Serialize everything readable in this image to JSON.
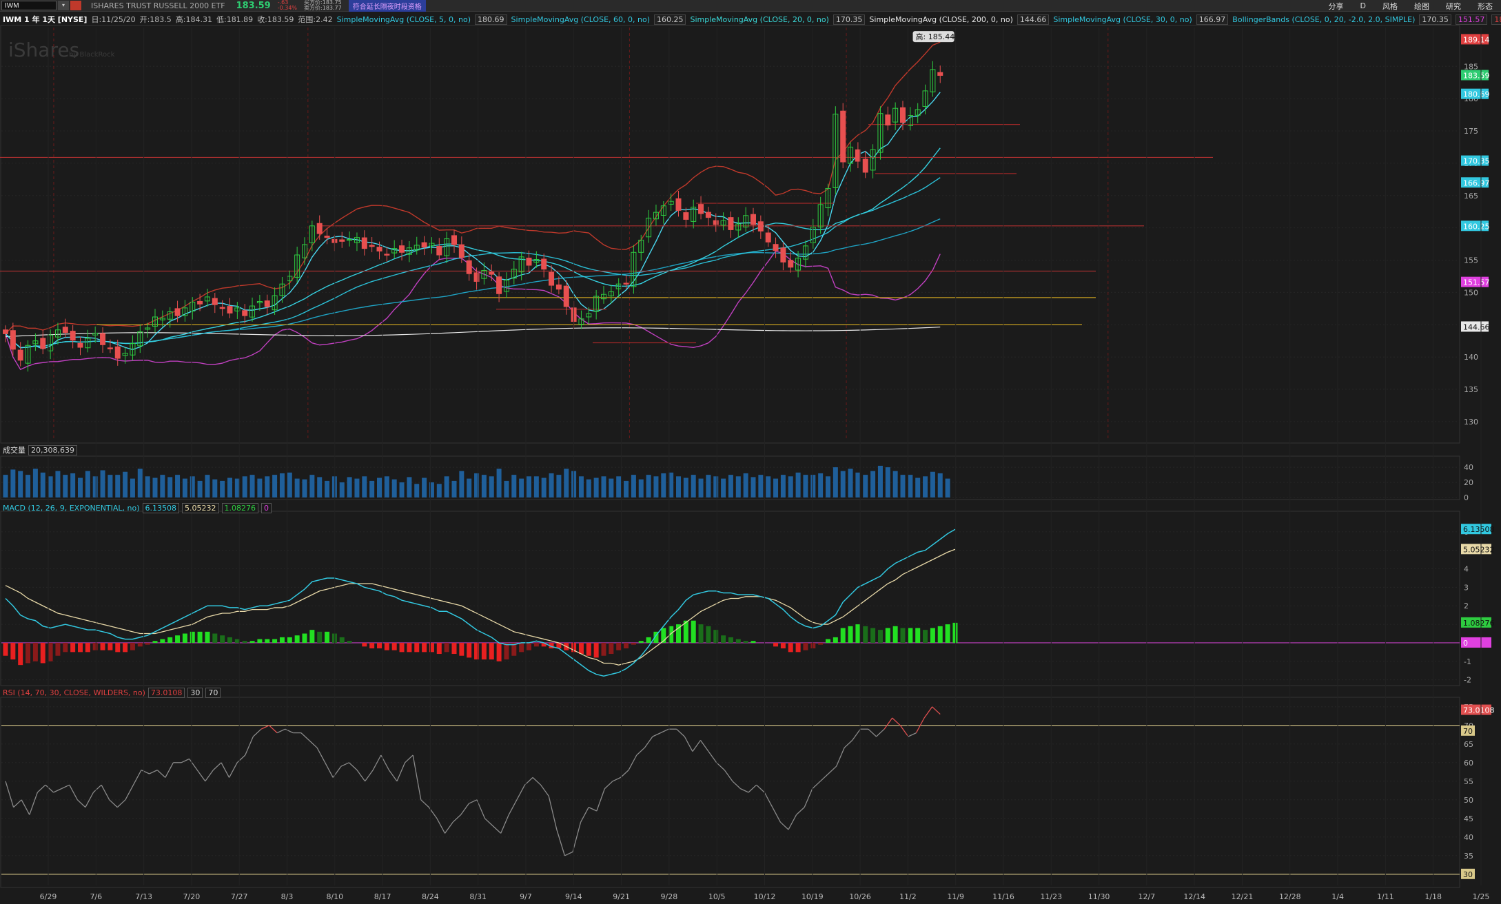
{
  "toolbar": {
    "symbol": "IWM",
    "name": "ISHARES TRUST RUSSELL 2000 ETF",
    "price": "183.59",
    "change": "-.63",
    "change_pct": "-0.34%",
    "bid": "买方价:183.75",
    "ask": "卖方价:183.77",
    "ext_hours": "符合延长隔夜时段资格",
    "right_items": [
      "分享",
      "D",
      "风格",
      "绘图",
      "研究",
      "形态"
    ]
  },
  "infobar": {
    "title": "IWM 1 年 1天 [NYSE]",
    "date": "日:11/25/20",
    "open": "开:183.5",
    "high": "高:184.31",
    "low": "低:181.89",
    "close": "收:183.59",
    "range": "范围:2.42",
    "studies": [
      {
        "label": "SimpleMovingAvg (CLOSE, 5, 0, no)",
        "value": "180.69",
        "color": "#32c8e0"
      },
      {
        "label": "SimpleMovingAvg (CLOSE, 60, 0, no)",
        "value": "160.25",
        "color": "#32c8e0"
      },
      {
        "label": "SimpleMovingAvg (CLOSE, 20, 0, no)",
        "value": "170.35",
        "color": "#32c8e0"
      },
      {
        "label": "SimpleMovingAvg (CLOSE, 200, 0, no)",
        "value": "144.66",
        "color": "#e8e8e8"
      },
      {
        "label": "SimpleMovingAvg (CLOSE, 30, 0, no)",
        "value": "166.97",
        "color": "#32c8e0"
      },
      {
        "label": "BollingerBands (CLOSE, 0, 20, -2.0, 2.0, SIMPLE)",
        "value": "170.35",
        "color": "#32c8e0"
      }
    ],
    "bb_lower": "151.57",
    "bb_upper": "189.14"
  },
  "watermark": "iShares",
  "watermark_sub": "by BlackRock",
  "high_tag": "高: 185.44",
  "volume_label": "成交量",
  "volume_value": "20,308,639",
  "macd_label": "MACD (12, 26, 9, EXPONENTIAL, no)",
  "macd_values": [
    "6.13508",
    "5.05232",
    "1.08276",
    "0"
  ],
  "rsi_label": "RSI (14, 70, 30, CLOSE, WILDERS, no)",
  "rsi_values": [
    "73.0108",
    "30",
    "70"
  ],
  "price_badges": [
    {
      "value": "189.14",
      "color": "#e04040",
      "y": 189.14
    },
    {
      "value": "183.59",
      "color": "#2ecc71",
      "y": 183.59
    },
    {
      "value": "180.69",
      "color": "#32c8e0",
      "y": 180.69
    },
    {
      "value": "170.35",
      "color": "#32c8e0",
      "y": 170.35
    },
    {
      "value": "166.97",
      "color": "#32c8e0",
      "y": 166.97
    },
    {
      "value": "160.25",
      "color": "#32c8e0",
      "y": 160.25
    },
    {
      "value": "151.57",
      "color": "#e040e0",
      "y": 151.57
    },
    {
      "value": "144.66",
      "color": "#e8e8e8",
      "y": 144.66
    }
  ],
  "chart_data": [
    {
      "type": "candlestick",
      "title": "IWM 1 年 1天 [NYSE]",
      "ylim": [
        127,
        191
      ],
      "y_ticks": [
        130,
        135,
        140,
        145,
        150,
        155,
        160,
        165,
        170,
        175,
        180,
        185
      ],
      "x_ticks": [
        "6/29",
        "7/6",
        "7/13",
        "7/20",
        "7/27",
        "8/3",
        "8/10",
        "8/17",
        "8/24",
        "8/31",
        "9/7",
        "9/14",
        "9/21",
        "9/28",
        "10/5",
        "10/12",
        "10/19",
        "10/26",
        "11/2",
        "11/9",
        "11/16",
        "11/23",
        "11/30",
        "12/7",
        "12/14",
        "12/21",
        "12/28",
        "1/4",
        "1/11",
        "1/18",
        "1/25"
      ],
      "close": [
        143.6,
        141.2,
        139.5,
        141.8,
        142.5,
        141.3,
        143.4,
        144.2,
        143.8,
        142.6,
        141.5,
        142.9,
        143.7,
        141.9,
        141.4,
        139.8,
        140.6,
        142.1,
        143.9,
        144.5,
        146.2,
        146.0,
        147.0,
        146.4,
        147.6,
        148.5,
        148.2,
        149.3,
        148.1,
        147.5,
        146.8,
        147.6,
        146.4,
        147.9,
        148.6,
        147.8,
        149.5,
        151.3,
        152.5,
        155.8,
        157.4,
        160.3,
        159.1,
        158.5,
        157.7,
        157.9,
        158.2,
        158.5,
        156.8,
        157.1,
        156.4,
        155.9,
        156.8,
        156.2,
        156.9,
        157.3,
        157.0,
        157.6,
        155.8,
        158.3,
        157.4,
        155.4,
        152.9,
        151.7,
        153.4,
        152.8,
        149.8,
        151.9,
        153.6,
        155.5,
        154.2,
        155.1,
        153.6,
        151.1,
        150.5,
        147.8,
        145.5,
        145.9,
        146.7,
        149.4,
        149.7,
        150.1,
        151.3,
        151.4,
        156.2,
        158.1,
        161.5,
        162.4,
        163.4,
        164.1,
        162.7,
        161.3,
        163.2,
        162.2,
        161.6,
        160.5,
        161.1,
        159.7,
        160.6,
        161.9,
        160.5,
        159.5,
        157.8,
        156.5,
        154.7,
        153.9,
        155.3,
        157.2,
        160.1,
        163.6,
        166.1,
        177.6,
        170.2,
        172.5,
        170.3,
        168.6,
        172.1,
        177.7,
        175.9,
        178.5,
        176.3,
        177.4,
        178.3,
        181.2,
        184.5,
        183.59
      ]
    },
    {
      "type": "bar",
      "title": "成交量",
      "y_ticks": [
        0,
        20,
        40
      ],
      "values": [
        30,
        37,
        35,
        30,
        38,
        33,
        28,
        35,
        30,
        32,
        26,
        35,
        28,
        36,
        30,
        30,
        34,
        25,
        38,
        28,
        26,
        30,
        27,
        30,
        25,
        28,
        22,
        30,
        24,
        22,
        26,
        25,
        28,
        30,
        25,
        28,
        30,
        32,
        33,
        25,
        24,
        30,
        27,
        22,
        28,
        20,
        27,
        25,
        28,
        22,
        26,
        28,
        24,
        20,
        27,
        18,
        26,
        20,
        18,
        28,
        22,
        35,
        25,
        32,
        30,
        28,
        38,
        22,
        30,
        25,
        28,
        28,
        26,
        32,
        30,
        38,
        35,
        28,
        24,
        26,
        28,
        25,
        28,
        22,
        30,
        24,
        30,
        28,
        32,
        33,
        28,
        26,
        30,
        25,
        30,
        28,
        25,
        30,
        28,
        32,
        27,
        30,
        28,
        25,
        30,
        28,
        33,
        30,
        30,
        32,
        28,
        40,
        35,
        38,
        33,
        30,
        35,
        42,
        40,
        35,
        30,
        30,
        26,
        28,
        34,
        32,
        25
      ]
    },
    {
      "type": "line",
      "title": "MACD (12, 26, 9, EXPONENTIAL, no)",
      "ylim": [
        -2.2,
        7.0
      ],
      "y_ticks": [
        -2,
        -1,
        0,
        1,
        2,
        3,
        4,
        5,
        6
      ],
      "series": [
        {
          "name": "MACD",
          "color": "#32c8e0",
          "values": [
            2.4,
            2.0,
            1.5,
            1.3,
            1.2,
            0.9,
            0.8,
            0.9,
            1.0,
            0.9,
            0.8,
            0.7,
            0.7,
            0.6,
            0.5,
            0.3,
            0.2,
            0.2,
            0.3,
            0.4,
            0.6,
            0.8,
            1.0,
            1.2,
            1.4,
            1.6,
            1.8,
            2.0,
            2.0,
            2.0,
            1.9,
            1.9,
            1.8,
            1.9,
            2.0,
            2.0,
            2.1,
            2.2,
            2.3,
            2.6,
            2.9,
            3.3,
            3.4,
            3.5,
            3.5,
            3.4,
            3.3,
            3.2,
            3.0,
            2.9,
            2.8,
            2.6,
            2.5,
            2.3,
            2.2,
            2.1,
            2.0,
            1.9,
            1.7,
            1.7,
            1.5,
            1.3,
            1.0,
            0.7,
            0.5,
            0.3,
            0.0,
            -0.1,
            -0.1,
            0.0,
            0.0,
            0.1,
            0.0,
            -0.2,
            -0.3,
            -0.6,
            -0.9,
            -1.2,
            -1.5,
            -1.7,
            -1.8,
            -1.7,
            -1.6,
            -1.4,
            -1.1,
            -0.7,
            -0.2,
            0.4,
            0.9,
            1.4,
            1.8,
            2.3,
            2.6,
            2.7,
            2.8,
            2.8,
            2.7,
            2.7,
            2.6,
            2.6,
            2.6,
            2.5,
            2.4,
            2.1,
            1.8,
            1.4,
            1.1,
            0.9,
            0.8,
            0.9,
            1.2,
            1.5,
            2.2,
            2.6,
            3.0,
            3.2,
            3.4,
            3.6,
            4.0,
            4.3,
            4.5,
            4.7,
            4.9,
            5.0,
            5.3,
            5.6,
            5.9,
            6.13508
          ]
        },
        {
          "name": "Avg",
          "color": "#e8d9a8",
          "values": [
            3.1,
            2.9,
            2.7,
            2.4,
            2.2,
            2.0,
            1.8,
            1.6,
            1.5,
            1.4,
            1.3,
            1.2,
            1.1,
            1.0,
            0.9,
            0.8,
            0.7,
            0.6,
            0.5,
            0.5,
            0.5,
            0.6,
            0.7,
            0.8,
            0.9,
            1.0,
            1.2,
            1.4,
            1.5,
            1.6,
            1.6,
            1.7,
            1.7,
            1.8,
            1.8,
            1.8,
            1.9,
            1.9,
            2.0,
            2.2,
            2.4,
            2.6,
            2.8,
            2.9,
            3.0,
            3.1,
            3.2,
            3.2,
            3.2,
            3.2,
            3.1,
            3.0,
            2.9,
            2.8,
            2.7,
            2.6,
            2.5,
            2.4,
            2.3,
            2.2,
            2.1,
            2.0,
            1.8,
            1.6,
            1.4,
            1.2,
            1.0,
            0.8,
            0.6,
            0.5,
            0.4,
            0.3,
            0.2,
            0.1,
            0.0,
            -0.2,
            -0.4,
            -0.6,
            -0.8,
            -0.9,
            -1.1,
            -1.1,
            -1.2,
            -1.1,
            -1.0,
            -0.8,
            -0.5,
            -0.2,
            0.1,
            0.5,
            0.8,
            1.1,
            1.4,
            1.7,
            1.9,
            2.1,
            2.3,
            2.4,
            2.4,
            2.5,
            2.5,
            2.5,
            2.4,
            2.3,
            2.1,
            1.9,
            1.6,
            1.3,
            1.1,
            1.0,
            1.0,
            1.2,
            1.4,
            1.7,
            2.0,
            2.3,
            2.6,
            2.9,
            3.2,
            3.4,
            3.7,
            3.9,
            4.1,
            4.3,
            4.5,
            4.7,
            4.9,
            5.05232
          ]
        },
        {
          "name": "Diff",
          "values": [
            -0.7,
            -0.9,
            -1.2,
            -1.1,
            -1.0,
            -1.1,
            -1.0,
            -0.7,
            -0.5,
            -0.5,
            -0.5,
            -0.5,
            -0.4,
            -0.4,
            -0.4,
            -0.5,
            -0.5,
            -0.4,
            -0.2,
            -0.1,
            0.1,
            0.2,
            0.3,
            0.4,
            0.5,
            0.6,
            0.6,
            0.6,
            0.5,
            0.4,
            0.3,
            0.2,
            0.1,
            0.1,
            0.2,
            0.2,
            0.2,
            0.3,
            0.3,
            0.4,
            0.5,
            0.7,
            0.6,
            0.6,
            0.5,
            0.3,
            0.1,
            0.0,
            -0.2,
            -0.3,
            -0.3,
            -0.4,
            -0.4,
            -0.5,
            -0.5,
            -0.5,
            -0.5,
            -0.5,
            -0.6,
            -0.5,
            -0.6,
            -0.7,
            -0.8,
            -0.9,
            -0.9,
            -0.9,
            -1.0,
            -0.9,
            -0.7,
            -0.5,
            -0.4,
            -0.2,
            -0.2,
            -0.3,
            -0.3,
            -0.4,
            -0.5,
            -0.6,
            -0.7,
            -0.8,
            -0.7,
            -0.6,
            -0.4,
            -0.3,
            -0.1,
            0.1,
            0.3,
            0.6,
            0.8,
            0.9,
            1.0,
            1.2,
            1.2,
            1.0,
            0.9,
            0.7,
            0.4,
            0.3,
            0.2,
            0.1,
            0.1,
            0.0,
            0.0,
            -0.2,
            -0.3,
            -0.5,
            -0.5,
            -0.4,
            -0.3,
            -0.1,
            0.2,
            0.3,
            0.8,
            0.9,
            1.0,
            0.9,
            0.8,
            0.7,
            0.8,
            0.9,
            0.8,
            0.8,
            0.8,
            0.7,
            0.8,
            0.9,
            1.0,
            1.08276
          ]
        }
      ]
    },
    {
      "type": "line",
      "title": "RSI (14, 70, 30, CLOSE, WILDERS, no)",
      "ylim": [
        27,
        77
      ],
      "y_ticks": [
        30,
        35,
        40,
        45,
        50,
        55,
        60,
        65,
        70,
        75
      ],
      "series": [
        {
          "name": "RSI",
          "values": [
            55,
            48,
            50,
            46,
            52,
            54,
            52,
            53,
            54,
            50,
            48,
            52,
            54,
            50,
            48,
            50,
            54,
            58,
            57,
            58,
            56,
            60,
            60,
            61,
            58,
            55,
            58,
            60,
            56,
            60,
            62,
            67,
            69,
            70,
            68,
            69,
            68,
            68,
            66,
            64,
            60,
            56,
            59,
            60,
            58,
            55,
            58,
            62,
            58,
            55,
            60,
            62,
            50,
            48,
            45,
            41,
            44,
            46,
            49,
            50,
            45,
            43,
            41,
            46,
            50,
            54,
            56,
            54,
            51,
            42,
            35,
            36,
            44,
            48,
            47,
            53,
            55,
            56,
            58,
            62,
            64,
            67,
            68,
            69,
            69,
            67,
            63,
            66,
            63,
            60,
            58,
            55,
            53,
            52,
            54,
            52,
            48,
            44,
            42,
            46,
            48,
            53,
            55,
            57,
            59,
            64,
            66,
            69,
            69,
            67,
            69,
            72,
            70,
            67,
            68,
            72,
            75,
            73.0108
          ]
        }
      ]
    }
  ]
}
